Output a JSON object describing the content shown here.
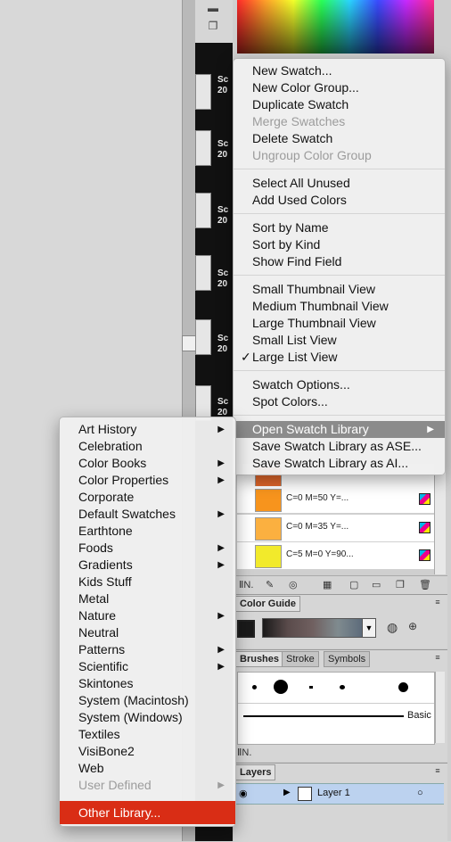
{
  "thumb_label_text": [
    "Sc",
    "20"
  ],
  "swatch_menu": {
    "items": [
      {
        "label": "New Swatch...",
        "enabled": true
      },
      {
        "label": "New Color Group...",
        "enabled": true
      },
      {
        "label": "Duplicate Swatch",
        "enabled": true
      },
      {
        "label": "Merge Swatches",
        "enabled": false
      },
      {
        "label": "Delete Swatch",
        "enabled": true
      },
      {
        "label": "Ungroup Color Group",
        "enabled": false
      },
      {
        "label": "Select All Unused",
        "enabled": true
      },
      {
        "label": "Add Used Colors",
        "enabled": true
      },
      {
        "label": "Sort by Name",
        "enabled": true
      },
      {
        "label": "Sort by Kind",
        "enabled": true
      },
      {
        "label": "Show Find Field",
        "enabled": true
      },
      {
        "label": "Small Thumbnail View",
        "enabled": true
      },
      {
        "label": "Medium Thumbnail View",
        "enabled": true
      },
      {
        "label": "Large Thumbnail View",
        "enabled": true
      },
      {
        "label": "Small List View",
        "enabled": true
      },
      {
        "label": "Large List View",
        "enabled": true,
        "checked": true
      },
      {
        "label": "Swatch Options...",
        "enabled": true
      },
      {
        "label": "Spot Colors...",
        "enabled": true
      },
      {
        "label": "Open Swatch Library",
        "enabled": true,
        "submenu": true,
        "highlighted": true
      },
      {
        "label": "Save Swatch Library as ASE...",
        "enabled": true
      },
      {
        "label": "Save Swatch Library as AI...",
        "enabled": true
      }
    ]
  },
  "library_menu": {
    "items": [
      {
        "label": "Art History",
        "submenu": true
      },
      {
        "label": "Celebration",
        "submenu": false
      },
      {
        "label": "Color Books",
        "submenu": true
      },
      {
        "label": "Color Properties",
        "submenu": true
      },
      {
        "label": "Corporate",
        "submenu": false
      },
      {
        "label": "Default Swatches",
        "submenu": true
      },
      {
        "label": "Earthtone",
        "submenu": false
      },
      {
        "label": "Foods",
        "submenu": true
      },
      {
        "label": "Gradients",
        "submenu": true
      },
      {
        "label": "Kids Stuff",
        "submenu": false
      },
      {
        "label": "Metal",
        "submenu": false
      },
      {
        "label": "Nature",
        "submenu": true
      },
      {
        "label": "Neutral",
        "submenu": false
      },
      {
        "label": "Patterns",
        "submenu": true
      },
      {
        "label": "Scientific",
        "submenu": true
      },
      {
        "label": "Skintones",
        "submenu": false
      },
      {
        "label": "System (Macintosh)",
        "submenu": false
      },
      {
        "label": "System (Windows)",
        "submenu": false
      },
      {
        "label": "Textiles",
        "submenu": false
      },
      {
        "label": "VisiBone2",
        "submenu": false
      },
      {
        "label": "Web",
        "submenu": false
      },
      {
        "label": "User Defined",
        "submenu": true,
        "enabled": false
      },
      {
        "label": "Other Library...",
        "submenu": false,
        "highlighted": true
      }
    ]
  },
  "swatches": [
    {
      "name": "",
      "color": "#e0662a"
    },
    {
      "name": "C=0 M=50 Y=...",
      "color": "#f7941d"
    },
    {
      "name": "C=0 M=35 Y=...",
      "color": "#fbb040"
    },
    {
      "name": "C=5 M=0 Y=90...",
      "color": "#f2ea2b"
    }
  ],
  "color_guide": {
    "tab": "Color Guide"
  },
  "brushes_panel": {
    "tabs": [
      "Brushes",
      "Stroke",
      "Symbols"
    ],
    "basic_label": "Basic"
  },
  "layers_panel": {
    "tab": "Layers",
    "layer_name": "Layer 1"
  },
  "colors": {
    "highlight": "#d92d15",
    "menu_highlight": "#8b8b8b",
    "layer_row": "#bcd2ef"
  }
}
